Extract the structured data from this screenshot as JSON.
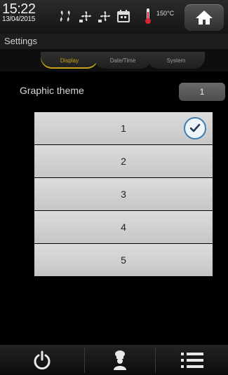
{
  "status": {
    "time": "15:22",
    "date": "13/04/2015",
    "temperature": "150°C"
  },
  "subtitle": "Settings",
  "tabs": [
    {
      "label": "Display",
      "active": true
    },
    {
      "label": "Date/Time",
      "active": false
    },
    {
      "label": "System",
      "active": false
    }
  ],
  "setting": {
    "label": "Graphic theme",
    "value": "1"
  },
  "options": [
    "1",
    "2",
    "3",
    "4",
    "5"
  ],
  "selected_option": "1",
  "colors": {
    "background": "#000000",
    "accent_tab": "#c9a21a",
    "check": "#3f7fb0",
    "list_item": "#d2d2d2"
  },
  "icons": {
    "home": "home-icon",
    "power": "power-icon",
    "chef": "chef-icon",
    "menu": "list-menu-icon"
  }
}
